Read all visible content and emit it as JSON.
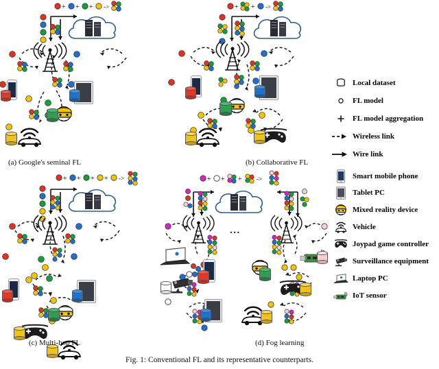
{
  "figure": {
    "caption": "Fig. 1: Conventional FL and its representative counterparts.",
    "panels": [
      {
        "id": "a",
        "caption": "(a) Google's seminal FL",
        "aggregation": "red + blue + green + yellow -> aggregated model",
        "description": "Cloud server connected by wire link to a base station; devices (smart mobile phone, tablet PC, mixed reality device, vehicle) exchange FL models with the base station over wireless links."
      },
      {
        "id": "b",
        "caption": "(b) Collaborative FL",
        "aggregation": "red + green-yellow cluster + blue -> aggregated model",
        "description": "Cloud server and base station with device-to-device collaborative wireless links between smart mobile phone, tablet PC, mixed reality device, vehicle and joypad game controller."
      },
      {
        "id": "c",
        "caption": "(c) Multi-hop FL",
        "aggregation": "red + blue + green + yellow + yellow -> aggregated model",
        "description": "Cloud server and base station with multi-hop relaying of FL models across phone, tablet, mixed reality device, joypad game controller and vehicle."
      },
      {
        "id": "d",
        "caption": "(d) Fog learning",
        "aggregation": "magenta + white + cluster + cluster -> aggregated model",
        "description": "Cloud server wire-linked to two base stations separated by an ellipsis; laptop PC, surveillance equipment, smart mobile phone, tablet PC, mixed reality device, joypad game controller, vehicle and IoT sensor form a multi-layer fog hierarchy."
      }
    ],
    "ellipsis": "..."
  },
  "legend_symbols": {
    "title": "symbol legend",
    "items": [
      {
        "icon": "cylinder-icon",
        "label": "Local dataset"
      },
      {
        "icon": "hollow-circle-icon",
        "label": "FL model"
      },
      {
        "icon": "plus-icon",
        "label": "FL model aggregation"
      },
      {
        "icon": "dashed-arrow-icon",
        "label": "Wireless link"
      },
      {
        "icon": "solid-arrow-icon",
        "label": "Wire link"
      }
    ]
  },
  "legend_devices": {
    "title": "device legend",
    "items": [
      {
        "icon": "smart-mobile-phone-icon",
        "label": "Smart mobile phone"
      },
      {
        "icon": "tablet-pc-icon",
        "label": "Tablet PC"
      },
      {
        "icon": "mixed-reality-device-icon",
        "label": "Mixed reality device"
      },
      {
        "icon": "vehicle-icon",
        "label": "Vehicle"
      },
      {
        "icon": "joypad-game-controller-icon",
        "label": "Joypad game controller"
      },
      {
        "icon": "surveillance-equipment-icon",
        "label": "Surveillance equipment"
      },
      {
        "icon": "laptop-pc-icon",
        "label": "Laptop PC"
      },
      {
        "icon": "iot-sensor-icon",
        "label": "IoT sensor"
      }
    ]
  },
  "colors": {
    "model_red": "#e8301f",
    "model_blue": "#1f6fd0",
    "model_green": "#13a03c",
    "model_yellow": "#f5c400",
    "model_magenta": "#e21ec6",
    "model_pink": "#f6cfd2",
    "cloud_outline": "#2e5f8a",
    "server_body": "#2b2b33",
    "link_color": "#1a1a1a"
  }
}
